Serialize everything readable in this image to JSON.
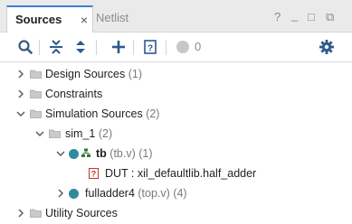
{
  "tabs": [
    {
      "label": "Sources",
      "active": true
    },
    {
      "label": "Netlist",
      "active": false
    }
  ],
  "tab_close_symbol": "×",
  "window_buttons": [
    "?",
    "_",
    "□",
    "⧉"
  ],
  "toolbar": {
    "icons": [
      "search-icon",
      "collapse-all-icon",
      "expand-all-icon",
      "add-icon",
      "properties-icon",
      "status-dot-icon",
      "gear-icon"
    ],
    "error_count": "0"
  },
  "tree": {
    "design_sources": {
      "label": "Design Sources",
      "count": "(1)"
    },
    "constraints": {
      "label": "Constraints"
    },
    "simulation_sources": {
      "label": "Simulation Sources",
      "count": "(2)"
    },
    "sim_1": {
      "label": "sim_1",
      "count": "(2)"
    },
    "tb": {
      "name": "tb",
      "file": "(tb.v)",
      "count": "(1)"
    },
    "dut": {
      "label": "DUT : xil_defaultlib.half_adder"
    },
    "fulladder4": {
      "name": "fulladder4",
      "file": "(top.v)",
      "count": "(4)"
    },
    "utility_sources": {
      "label": "Utility Sources"
    }
  },
  "colors": {
    "accent": "#3c7dcc",
    "module_dot": "#2f8a9e",
    "folder": "#bfbfbf"
  }
}
